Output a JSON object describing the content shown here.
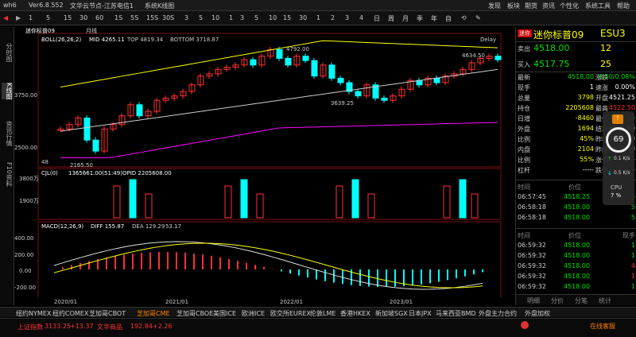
{
  "window": {
    "app": "wh6",
    "version": "Ver6.8.552",
    "server": "文华云节点-江苏电信1",
    "view": "系统K线图"
  },
  "toolbar": [
    "1",
    "5",
    "15",
    "30",
    "60",
    "1S",
    "5S",
    "15S",
    "30S",
    "3",
    "5",
    "10",
    "1",
    "3",
    "5",
    "10",
    "15",
    "30",
    "1",
    "2",
    "3",
    "4",
    "日",
    "周",
    "月",
    "季",
    "年",
    "自",
    "⟲",
    "✎"
  ],
  "top_menu": [
    "发现",
    "板块",
    "期货",
    "资讯",
    "个性化",
    "系统工具",
    "帮助"
  ],
  "sidetabs": [
    "分时图",
    "K线图",
    "资讯行情",
    "F10资料"
  ],
  "chart": {
    "header": {
      "name": "迷你标普09",
      "period": "月线"
    },
    "boll": {
      "label": "BOLL(26,26,2)",
      "mid": "MID 4265.11",
      "top": "TOP 4819.34",
      "bottom": "BOTTOM 3718.87"
    },
    "delay": "Delay",
    "price_axis": [
      "3750.00",
      "2500.00"
    ],
    "annotations": {
      "high1": "4792.00",
      "high2": "4634.50",
      "low1": "3639.25",
      "low2": "2165.50",
      "cnt": "48"
    },
    "cjl": {
      "label": "CJL(0)",
      "vol": "1365661.00(51:49)",
      "opid": "OPID 2205608.00",
      "axis": [
        "3800万",
        "1900万"
      ]
    },
    "macd": {
      "label": "MACD(12,26,9)",
      "diff": "DIFF 155.87",
      "dea": "DEA 129.29",
      "m": "53.17",
      "axis": [
        "400.00",
        "200.00",
        "0.00",
        "-200.00"
      ]
    },
    "x_axis": [
      "2020/01",
      "2021/01",
      "2022/01",
      "2023/01"
    ]
  },
  "quote": {
    "badge": "迷你",
    "title": "迷你标普09",
    "code": "ESU3",
    "sell": {
      "label": "卖出",
      "price": "4518.00",
      "qty": "12"
    },
    "buy": {
      "label": "买入",
      "price": "4517.75",
      "qty": "25"
    },
    "rows": [
      {
        "l": "最新",
        "v": "4518.00",
        "l2": "涨跌",
        "v2": "-3.50/0.08%"
      },
      {
        "l": "现手",
        "v": "1",
        "l2": "速涨",
        "v2": "0.00%"
      },
      {
        "l": "总量",
        "v": "3798",
        "l2": "开盘",
        "v2": "4521.25"
      },
      {
        "l": "持仓",
        "v": "2205608",
        "l2": "最高",
        "v2": "4522.50"
      },
      {
        "l": "日增",
        "v": "-8460",
        "l2": "最低",
        "v2": "4516.50"
      },
      {
        "l": "外盘",
        "v": "1694",
        "l2": "结算价",
        "v2": "4521.50"
      },
      {
        "l": "比例",
        "v": "45%",
        "l2": "昨收",
        "v2": "4521.50"
      },
      {
        "l": "内盘",
        "v": "2104",
        "l2": "昨结",
        "v2": "4521.50"
      },
      {
        "l": "比例",
        "v": "55%",
        "l2": "涨停",
        "v2": "----"
      },
      {
        "l": "杠杆",
        "v": "-----",
        "l2": "跌停",
        "v2": "----"
      }
    ],
    "ticks1_header": [
      "时间",
      "价位",
      ""
    ],
    "ticks1": [
      {
        "t": "06:57:45",
        "p": "4518.25",
        "q": "6"
      },
      {
        "t": "06:58:18",
        "p": "4518.00",
        "q": "5"
      },
      {
        "t": "06:58:18",
        "p": "4518.00",
        "q": "5"
      }
    ],
    "ticks2_header": [
      "时间",
      "价位",
      "现手"
    ],
    "ticks2": [
      {
        "t": "06:59:32",
        "p": "4518.00",
        "q": "1"
      },
      {
        "t": "06:59:32",
        "p": "4518.00",
        "q": "1"
      },
      {
        "t": "06:59:32",
        "p": "4518.00",
        "q": "4"
      },
      {
        "t": "06:59:32",
        "p": "4518.00",
        "q": "1"
      },
      {
        "t": "06:59:32",
        "p": "4518.00",
        "q": "1"
      }
    ],
    "bottom_tabs": [
      "明细",
      "分价",
      "分笔",
      "统计"
    ]
  },
  "widget": {
    "score": "69",
    "net_up": "0.1 K/s",
    "net_down": "0.5 K/s",
    "cpu_label": "CPU",
    "cpu_pct": "7 %"
  },
  "exchanges": [
    "纽约NYMEX",
    "纽约COMEX",
    "芝加哥CBOT",
    "芝加哥CME",
    "芝加哥CBOE",
    "美国ICE",
    "欧洲ICE",
    "欧交所EUREX",
    "伦敦LME",
    "香港HKEX",
    "新加坡SGX",
    "日本JPX",
    "马来西亚BMD",
    "外盘主力合约",
    "外盘加权"
  ],
  "status": {
    "idx1_name": "上证指数",
    "idx1": "3133.25",
    "idx1_chg": "+13.37",
    "idx2_name": "文华商品",
    "idx2": "192.84",
    "idx2_chg": "+2.26",
    "online": "在线客服"
  },
  "colors": {
    "up": "#ff3030",
    "down": "#00ffff",
    "mid_line": "#cccccc",
    "top_line": "#ffff00",
    "bottom_line": "#ff00ff"
  }
}
